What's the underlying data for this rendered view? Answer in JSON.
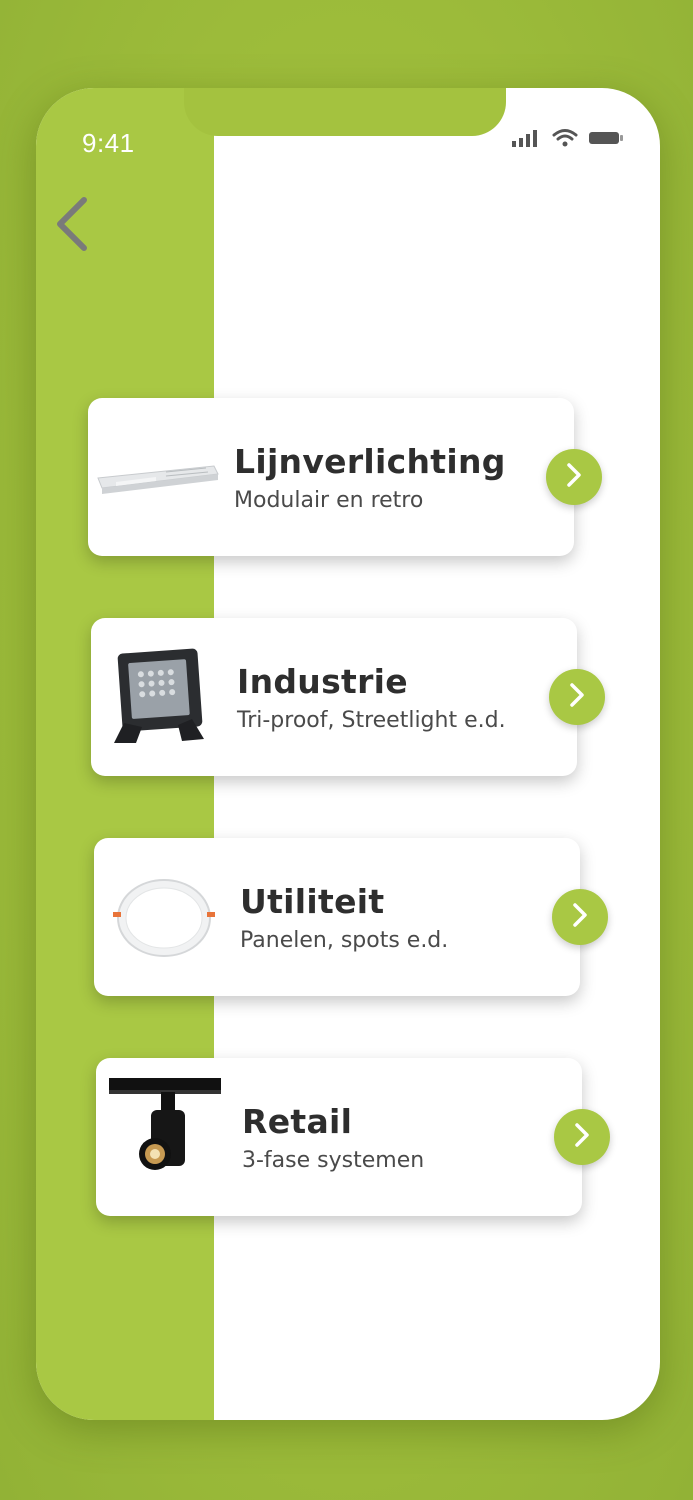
{
  "status_bar": {
    "time": "9:41",
    "icons": [
      "signal-icon",
      "wifi-icon",
      "battery-icon"
    ]
  },
  "nav": {
    "back_icon": "chevron-left-icon"
  },
  "colors": {
    "accent": "#a9c844",
    "background": "#9cbb3a",
    "card": "#ffffff",
    "title": "#2e2e2e",
    "subtitle": "#4a4a4a"
  },
  "categories": [
    {
      "title": "Lijnverlichting",
      "subtitle": "Modulair en retro",
      "image": "linear-light-fixture",
      "action_icon": "chevron-right-icon"
    },
    {
      "title": "Industrie",
      "subtitle": "Tri-proof, Streetlight e.d.",
      "image": "floodlight",
      "action_icon": "chevron-right-icon"
    },
    {
      "title": "Utiliteit",
      "subtitle": "Panelen, spots e.d.",
      "image": "recessed-downlight",
      "action_icon": "chevron-right-icon"
    },
    {
      "title": "Retail",
      "subtitle": "3-fase systemen",
      "image": "track-spotlight",
      "action_icon": "chevron-right-icon"
    }
  ]
}
